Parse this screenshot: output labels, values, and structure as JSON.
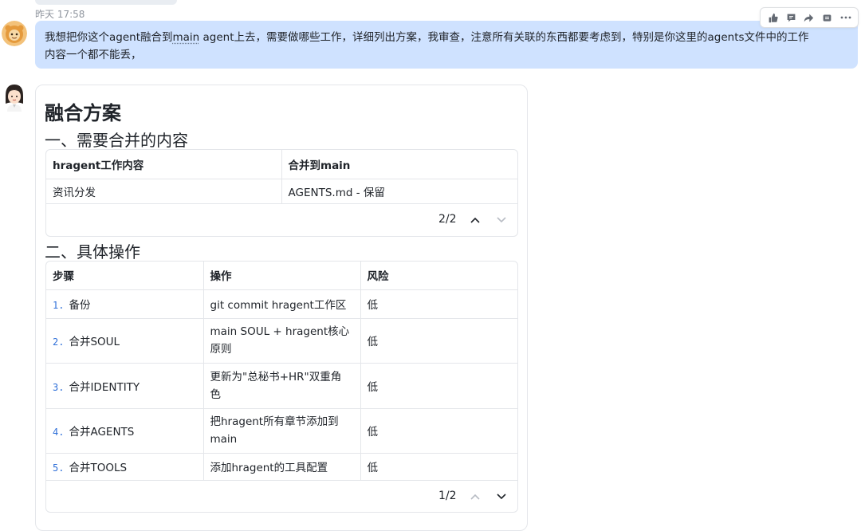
{
  "conversation": {
    "timestamp": "昨天 17:58",
    "user_message": {
      "line1_a": "我想把你这个agent融合到",
      "line1_link": "main",
      "line1_b": " agent上去，需要做哪些工作，详细列出方案，我审查，注意所有关联的东西都要考虑到，特别是你这里的agents文件中的工作",
      "line2": "内容一个都不能丢，"
    },
    "toolbar_icons": [
      "thumbs-up-icon",
      "comment-icon",
      "forward-icon",
      "quote-icon",
      "more-icon"
    ]
  },
  "reply": {
    "title": "融合方案",
    "section1": {
      "heading": "一、需要合并的内容",
      "headers": [
        "hragent工作内容",
        "合并到main"
      ],
      "rows": [
        [
          "资讯分发",
          "AGENTS.md - 保留"
        ]
      ],
      "pager": "2/2"
    },
    "section2": {
      "heading": "二、具体操作",
      "headers": [
        "步骤",
        "操作",
        "风险"
      ],
      "rows": [
        {
          "num": "1.",
          "step": "备份",
          "op": "git commit hragent工作区",
          "risk": "低"
        },
        {
          "num": "2.",
          "step": "合并SOUL",
          "op_a": "main SOUL + hragent核心",
          "op_b": "原则",
          "risk": "低"
        },
        {
          "num": "3.",
          "step": "合并IDENTITY",
          "op_a": "更新为\"总秘书+HR\"双重角",
          "op_b": "色",
          "risk": "低"
        },
        {
          "num": "4.",
          "step": "合并AGENTS",
          "op_a": "把hragent所有章节添加到",
          "op_b": "main",
          "risk": "低"
        },
        {
          "num": "5.",
          "step": "合并TOOLS",
          "op": "添加hragent的工具配置",
          "risk": "低"
        }
      ],
      "pager": "1/2"
    }
  },
  "colors": {
    "user_bubble": "#cfe2ff",
    "step_number": "#2e6fd8",
    "border": "#e4e6ea"
  }
}
